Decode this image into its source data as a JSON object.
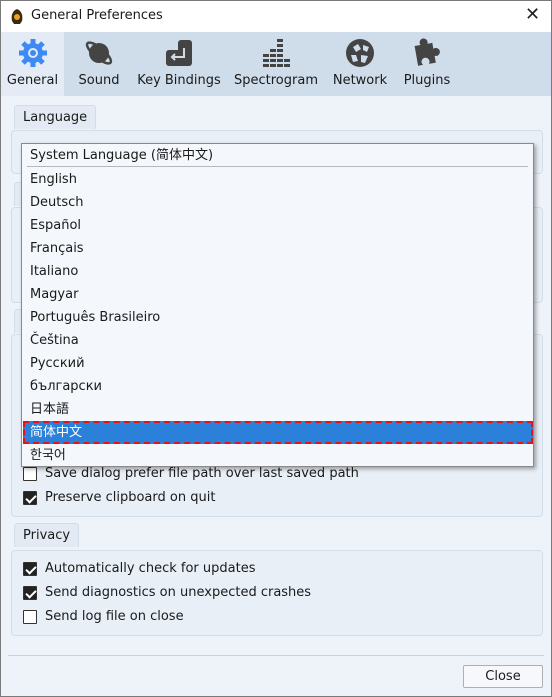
{
  "window": {
    "title": "General Preferences",
    "close_icon": "close-icon"
  },
  "tabs": [
    {
      "label": "General",
      "icon": "gear-icon",
      "selected": true
    },
    {
      "label": "Sound",
      "icon": "planet-icon"
    },
    {
      "label": "Key Bindings",
      "icon": "enter-key-icon"
    },
    {
      "label": "Spectrogram",
      "icon": "equalizer-icon"
    },
    {
      "label": "Network",
      "icon": "globe-icon"
    },
    {
      "label": "Plugins",
      "icon": "puzzle-icon"
    }
  ],
  "language": {
    "group_label": "Language",
    "selected": "System Language (简体中文)",
    "options": [
      "System Language (简体中文)",
      "English",
      "Deutsch",
      "Español",
      "Français",
      "Italiano",
      "Magyar",
      "Português Brasileiro",
      "Čeština",
      "Русский",
      "български",
      "日本語",
      "简体中文",
      "한국어"
    ],
    "highlighted": "简体中文"
  },
  "general_options": [
    {
      "label": "Save dialog prefer file path over last saved path",
      "checked": false
    },
    {
      "label": "Preserve clipboard on quit",
      "checked": true
    }
  ],
  "privacy": {
    "group_label": "Privacy",
    "options": [
      {
        "label": "Automatically check for updates",
        "checked": true
      },
      {
        "label": "Send diagnostics on unexpected crashes",
        "checked": true
      },
      {
        "label": "Send log file on close",
        "checked": false
      }
    ]
  },
  "footer": {
    "close_label": "Close"
  },
  "colors": {
    "accent": "#2b80d9",
    "toolbar": "#cfdcea",
    "gear": "#3d8af7",
    "focus": "#e0141a"
  }
}
